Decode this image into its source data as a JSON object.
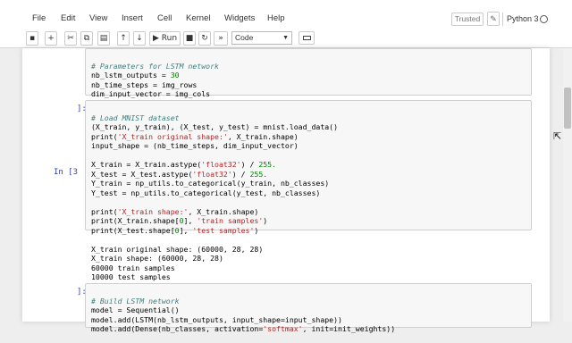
{
  "menubar": {
    "items": [
      "File",
      "Edit",
      "View",
      "Insert",
      "Cell",
      "Kernel",
      "Widgets",
      "Help"
    ],
    "trusted": "Trusted",
    "kernel": "Python 3"
  },
  "toolbar": {
    "run_label": "Run",
    "cell_type": "Code"
  },
  "cells": [
    {
      "prompt": "",
      "lines": [
        "# Parameters for LSTM network",
        "nb_lstm_outputs = 30",
        "nb_time_steps = img_rows",
        "dim_input_vector = img_cols"
      ]
    },
    {
      "prompt": "In [3",
      "top_prompt": "]:",
      "lines": [
        "# Load MNIST dataset",
        "(X_train, y_train), (X_test, y_test) = mnist.load_data()",
        "print('X_train original shape:', X_train.shape)",
        "input_shape = (nb_time_steps, dim_input_vector)",
        "",
        "X_train = X_train.astype('float32') / 255.",
        "X_test = X_test.astype('float32') / 255.",
        "Y_train = np_utils.to_categorical(y_train, nb_classes)",
        "Y_test = np_utils.to_categorical(y_test, nb_classes)",
        "",
        "print('X_train shape:', X_train.shape)",
        "print(X_train.shape[0], 'train samples')",
        "print(X_test.shape[0], 'test samples')"
      ],
      "output": [
        "X_train original shape: (60000, 28, 28)",
        "X_train shape: (60000, 28, 28)",
        "60000 train samples",
        "10000 test samples"
      ]
    },
    {
      "prompt": "]:",
      "lines": [
        "# Build LSTM network",
        "model = Sequential()",
        "model.add(LSTM(nb_lstm_outputs, input_shape=input_shape))",
        "model.add(Dense(nb_classes, activation='softmax', init=init_weights))"
      ]
    }
  ]
}
